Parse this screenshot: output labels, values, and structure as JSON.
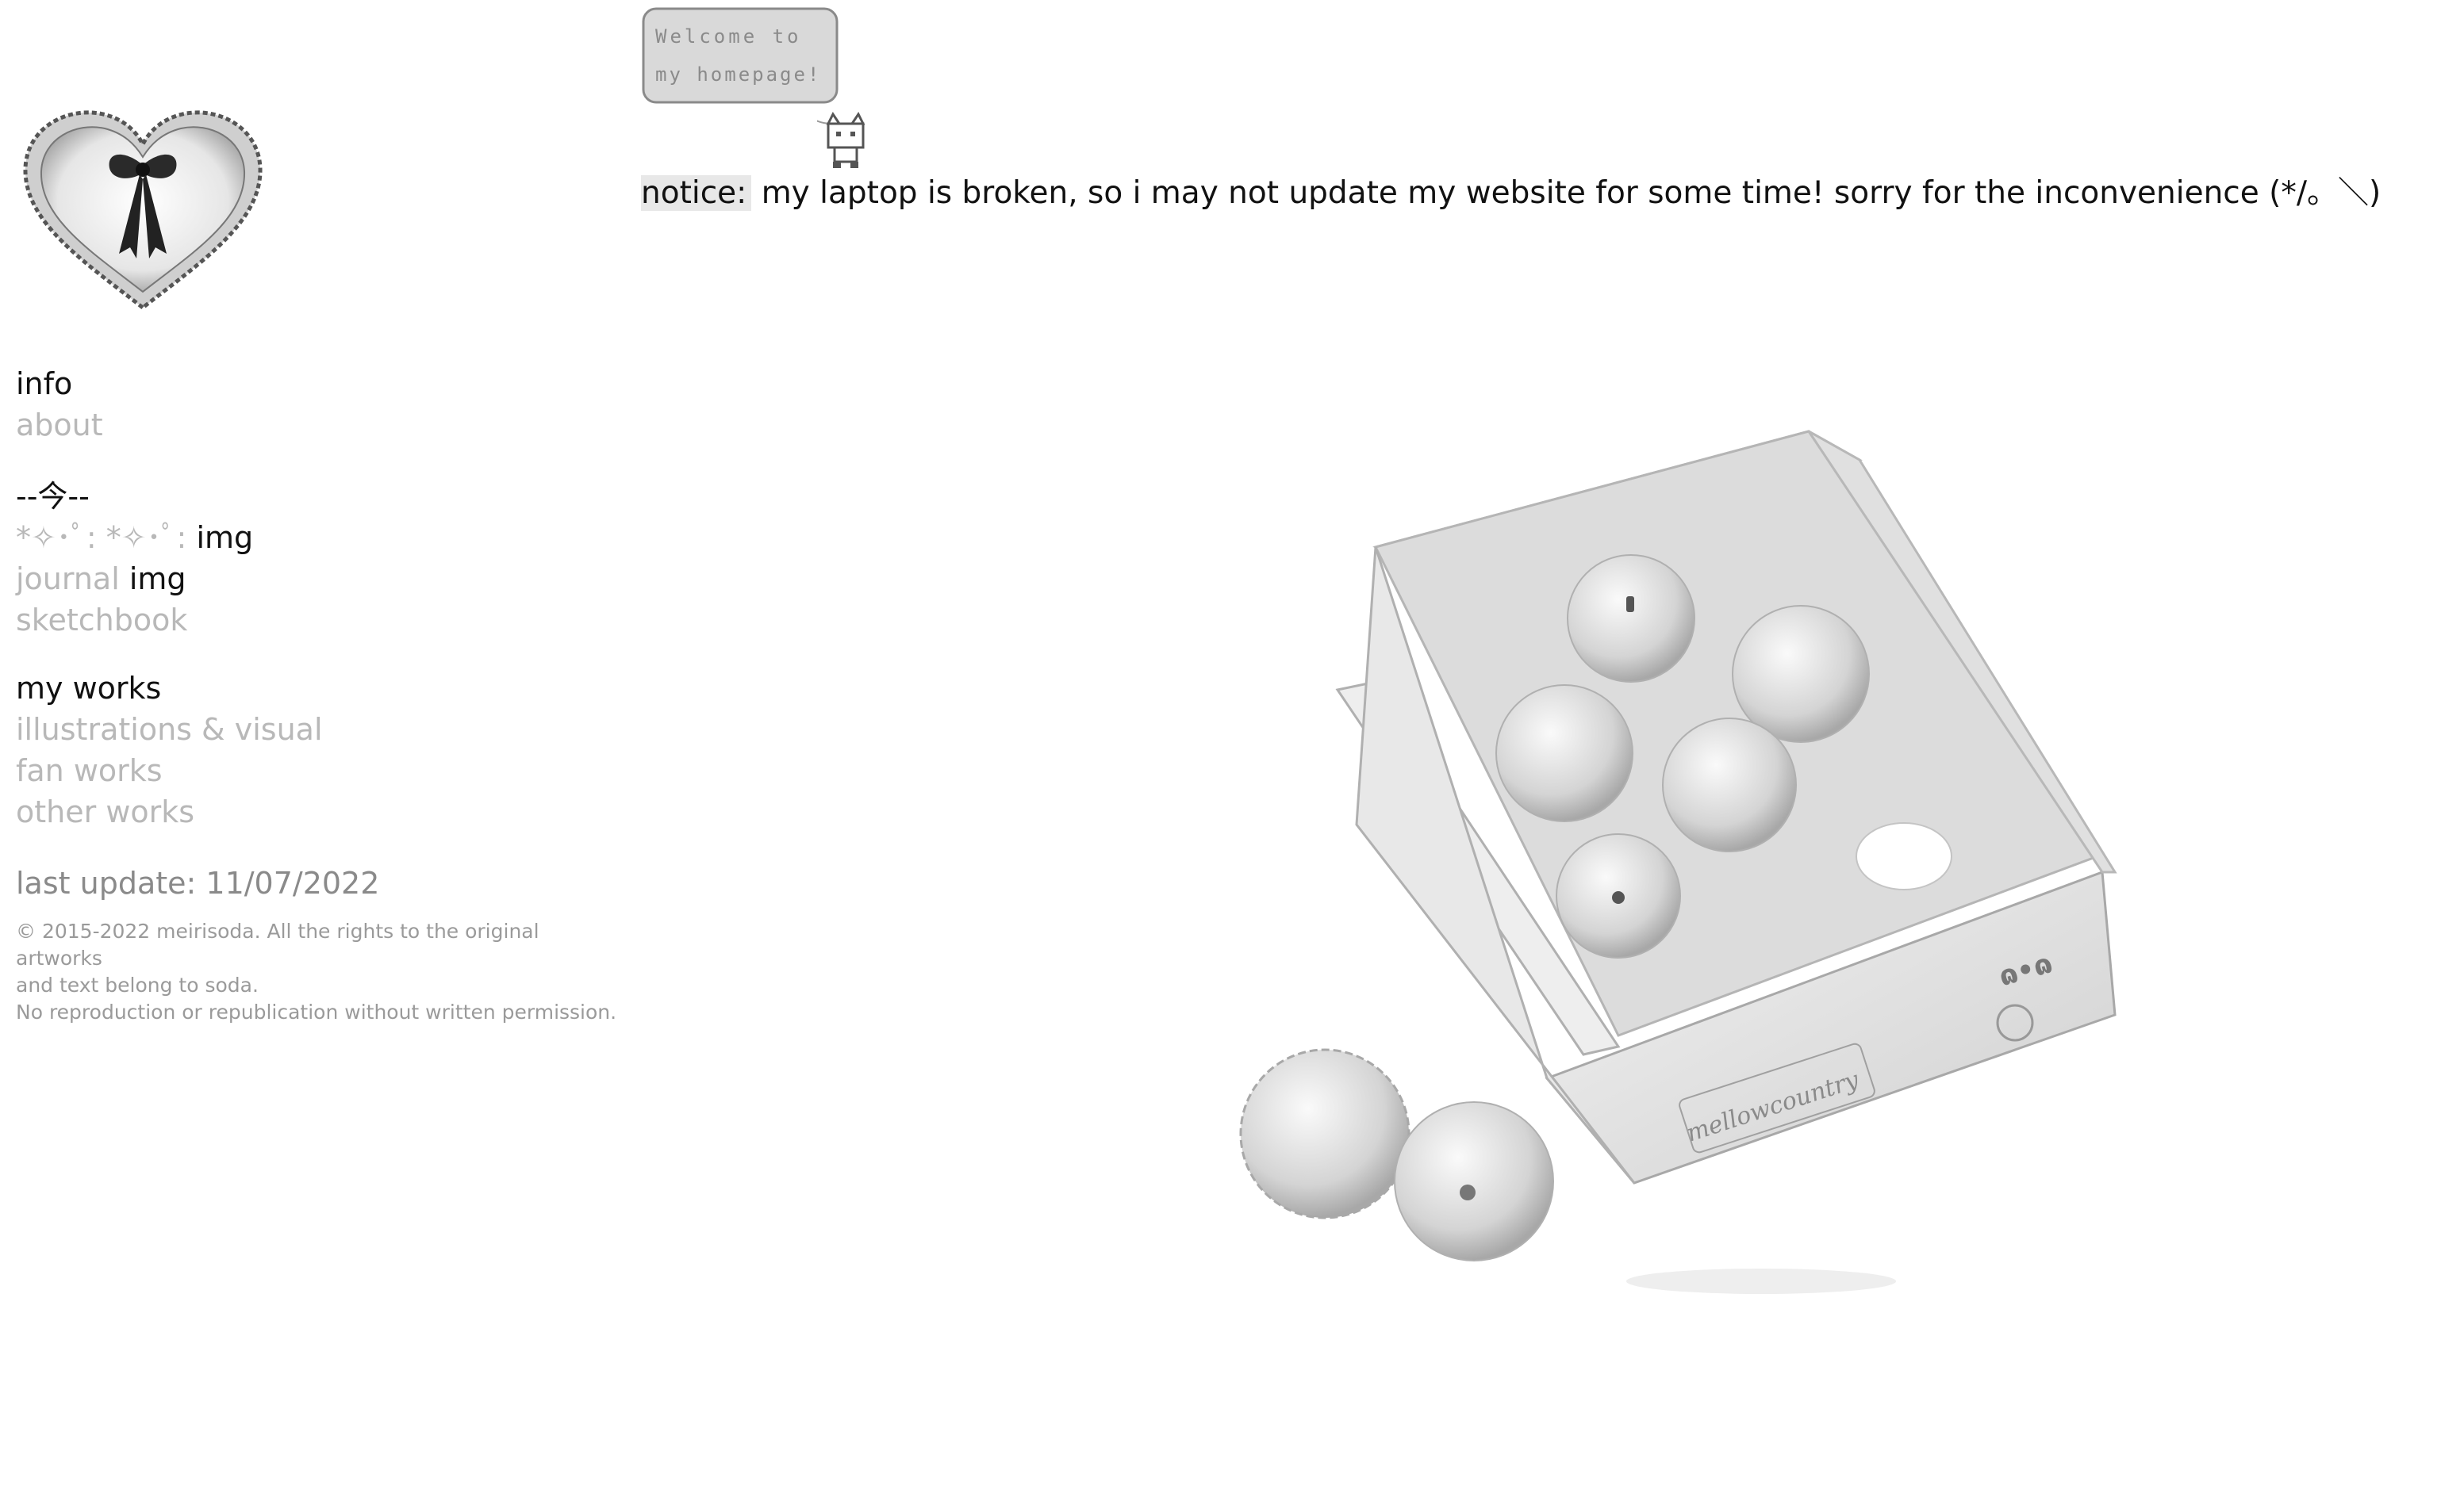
{
  "banner": {
    "bubble_line1": "Welcome to",
    "bubble_line2": "my homepage!",
    "notice_label": "notice:",
    "notice_text": " my laptop is broken, so i may not update my website for some time! sorry for the inconvenience (*/。＼)"
  },
  "sidebar": {
    "logo_icon": "bow-heart-icon",
    "info_heading": "info",
    "about_link": "about",
    "section2_heading": "--今--",
    "sparkle_link": "*✧･ﾟ: *✧･ﾟ:",
    "sparkle_img": " img",
    "journal_link": "journal",
    "journal_img": " img",
    "sketchbook_link": "sketchbook",
    "works_heading": "my works",
    "illustrations_link": "illustrations & visual",
    "fanworks_link": "fan works",
    "otherworks_link": "other works",
    "last_update": "last update: 11/07/2022",
    "copyright_line1": "© 2015-2022 meirisoda. All the rights to the original artworks",
    "copyright_line2": "and text belong to soda.",
    "copyright_line3": "No reproduction or republication without written permission."
  },
  "photo": {
    "box_label_top": "ɷ•ɷ",
    "box_label_brand": "mellowcountry"
  },
  "colors": {
    "text": "#111111",
    "link_gray": "#b8b8b8",
    "muted": "#8a8a8a",
    "notice_bg": "#e8e8e8"
  }
}
